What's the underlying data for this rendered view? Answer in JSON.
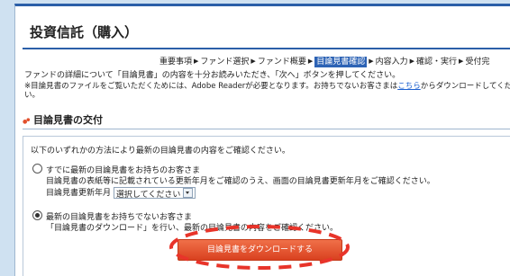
{
  "page": {
    "title": "投資信託（購入）"
  },
  "breadcrumb": {
    "items": [
      {
        "label": "重要事項",
        "current": false
      },
      {
        "label": "ファンド選択",
        "current": false
      },
      {
        "label": "ファンド概要",
        "current": false
      },
      {
        "label": "目論見書確認",
        "current": true
      },
      {
        "label": "内容入力",
        "current": false
      },
      {
        "label": "確認・実行",
        "current": false
      },
      {
        "label": "受付完",
        "current": false
      }
    ],
    "separator": "▶"
  },
  "intro": {
    "text": "ファンドの詳細について「目論見書」の内容を十分お読みいただき、「次へ」ボタンを押してください。",
    "note_prefix": "※目論見書のファイルをご覧いただくためには、Adobe Readerが必要となります。お持ちでないお客さまは",
    "note_link": "こちら",
    "note_suffix": "からダウンロードしてください。"
  },
  "section": {
    "heading": "目論見書の交付",
    "box_intro": "以下のいずれかの方法により最新の目論見書の内容をご確認ください。",
    "option1": {
      "label": "すでに最新の目論見書をお持ちのお客さま",
      "line2": "目論見書の表紙等に記載されている更新年月をご確認のうえ、画面の目論見書更新年月をご確認ください。",
      "field_label": "目論見書更新年月",
      "select_value": "選択してください",
      "selected": false
    },
    "option2": {
      "label": "最新の目論見書をお持ちでないお客さま",
      "line2": "「目論見書のダウンロード」を行い、最新の目論見書の内容をご確認ください。",
      "selected": true
    },
    "download_button": "目論見書をダウンロードする"
  },
  "colors": {
    "accent": "#2b5fa8",
    "button": "#e2502c",
    "highlight": "#e8342a"
  }
}
